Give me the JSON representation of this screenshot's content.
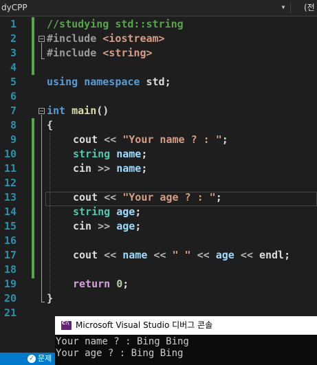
{
  "navbar": {
    "project": "dyCPP",
    "scope": "(전"
  },
  "line_numbers": [
    "1",
    "2",
    "3",
    "4",
    "5",
    "6",
    "7",
    "8",
    "9",
    "10",
    "11",
    "12",
    "13",
    "14",
    "15",
    "16",
    "17",
    "18",
    "19",
    "20",
    "21"
  ],
  "code": {
    "l1": "//studying std::string",
    "l2_dir": "#include",
    "l2_hdr": "<iostream>",
    "l3_dir": "#include",
    "l3_hdr": "<string>",
    "l5_using": "using",
    "l5_ns": "namespace",
    "l5_std": "std;",
    "l7_int": "int",
    "l7_main": "main",
    "l7_parens": "()",
    "l8": "{",
    "l9_cout": "cout",
    "l9_op": "<<",
    "l9_str": "\"Your name ? : \"",
    "l9_end": ";",
    "l10_type": "string",
    "l10_var": "name",
    "l10_end": ";",
    "l11_cin": "cin",
    "l11_op": ">>",
    "l11_var": "name",
    "l11_end": ";",
    "l13_cout": "cout",
    "l13_op": "<<",
    "l13_str": "\"Your age ? : \"",
    "l13_end": ";",
    "l14_type": "string",
    "l14_var": "age",
    "l14_end": ";",
    "l15_cin": "cin",
    "l15_op": ">>",
    "l15_var": "age",
    "l15_end": ";",
    "l17_cout": "cout",
    "l17_op1": "<<",
    "l17_v1": "name",
    "l17_op2": "<<",
    "l17_str": "\" \"",
    "l17_op3": "<<",
    "l17_v2": "age",
    "l17_op4": "<<",
    "l17_endl": "endl",
    "l17_end": ";",
    "l19_ret": "return",
    "l19_num": "0",
    "l19_end": ";",
    "l20": "}"
  },
  "console": {
    "title": "Microsoft Visual Studio 디버그 콘솔",
    "output": [
      "Your name ? : Bing Bing",
      "Your age ? : Bing Bing"
    ]
  },
  "statusbar": {
    "text": "문제"
  },
  "colors": {
    "accent": "#007acc",
    "change_bar": "#57a64a",
    "line_number": "#2b91af"
  }
}
